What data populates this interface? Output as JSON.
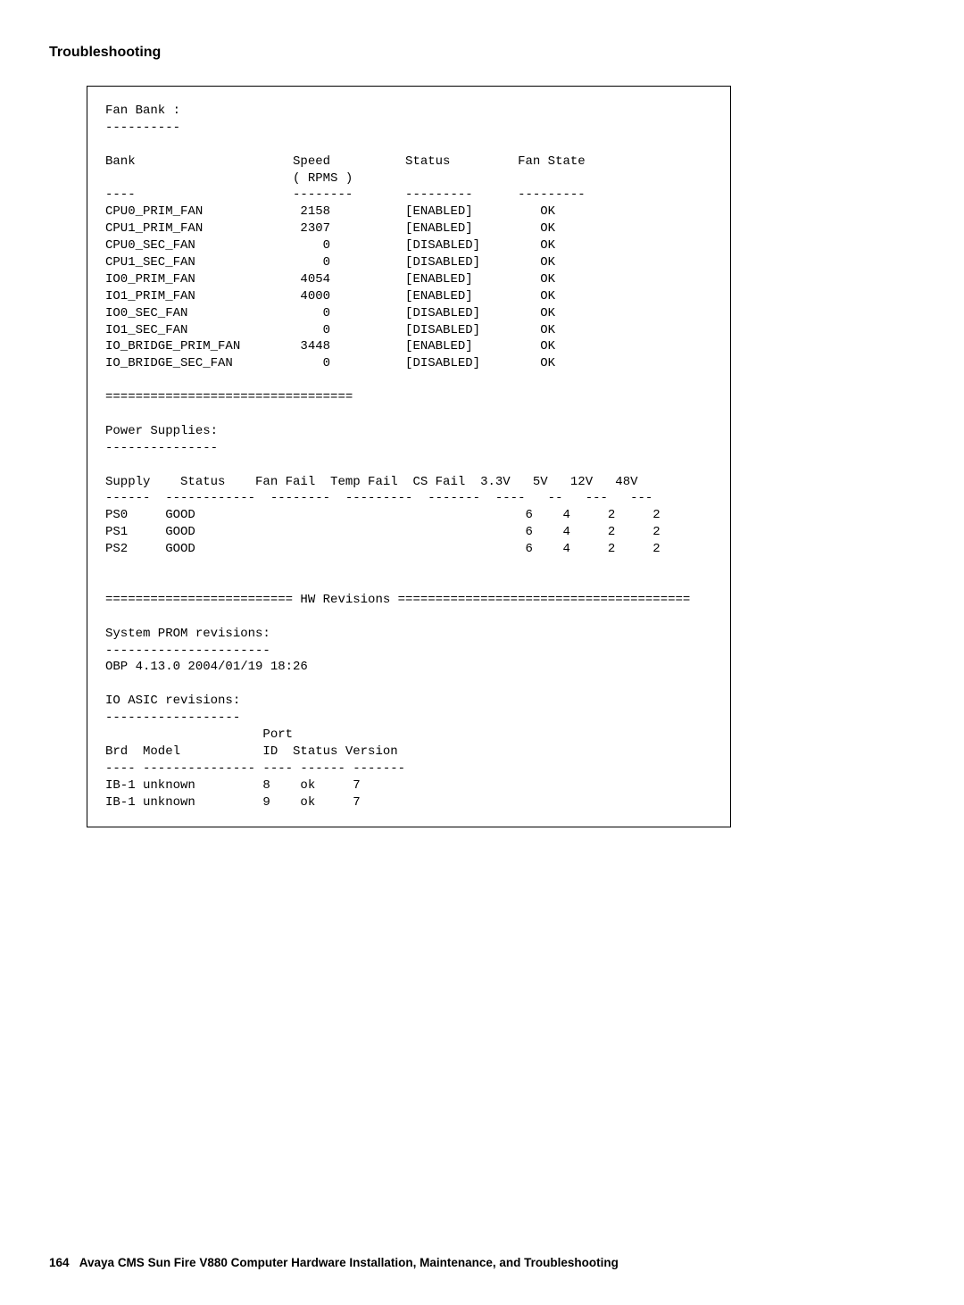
{
  "heading": "Troubleshooting",
  "fan_bank": {
    "title": "Fan Bank :",
    "title_underline": "----------",
    "hdr_bank": "Bank",
    "hdr_speed": "Speed",
    "hdr_rpm": "( RPMS )",
    "hdr_status": "Status",
    "hdr_state": "Fan State",
    "dash_bank": "----",
    "dash_speed": "--------",
    "dash_status": "---------",
    "dash_state": "---------",
    "rows": [
      {
        "bank": "CPU0_PRIM_FAN",
        "speed": "2158",
        "status": "[ENABLED]",
        "state": "OK"
      },
      {
        "bank": "CPU1_PRIM_FAN",
        "speed": "2307",
        "status": "[ENABLED]",
        "state": "OK"
      },
      {
        "bank": "CPU0_SEC_FAN",
        "speed": "0",
        "status": "[DISABLED]",
        "state": "OK"
      },
      {
        "bank": "CPU1_SEC_FAN",
        "speed": "0",
        "status": "[DISABLED]",
        "state": "OK"
      },
      {
        "bank": "IO0_PRIM_FAN",
        "speed": "4054",
        "status": "[ENABLED]",
        "state": "OK"
      },
      {
        "bank": "IO1_PRIM_FAN",
        "speed": "4000",
        "status": "[ENABLED]",
        "state": "OK"
      },
      {
        "bank": "IO0_SEC_FAN",
        "speed": "0",
        "status": "[DISABLED]",
        "state": "OK"
      },
      {
        "bank": "IO1_SEC_FAN",
        "speed": "0",
        "status": "[DISABLED]",
        "state": "OK"
      },
      {
        "bank": "IO_BRIDGE_PRIM_FAN",
        "speed": "3448",
        "status": "[ENABLED]",
        "state": "OK"
      },
      {
        "bank": "IO_BRIDGE_SEC_FAN",
        "speed": "0",
        "status": "[DISABLED]",
        "state": "OK"
      }
    ]
  },
  "divider1": "=================================",
  "power": {
    "title": "Power Supplies:",
    "title_underline": "---------------",
    "hdr": "Supply    Status    Fan Fail  Temp Fail  CS Fail  3.3V   5V   12V   48V",
    "dash": "------  ------------  --------  ---------  -------  ----   --   ---   ---",
    "rows": [
      {
        "supply": "PS0",
        "status": "GOOD",
        "v33": "6",
        "v5": "4",
        "v12": "2",
        "v48": "2"
      },
      {
        "supply": "PS1",
        "status": "GOOD",
        "v33": "6",
        "v5": "4",
        "v12": "2",
        "v48": "2"
      },
      {
        "supply": "PS2",
        "status": "GOOD",
        "v33": "6",
        "v5": "4",
        "v12": "2",
        "v48": "2"
      }
    ]
  },
  "hw_divider": "========================= HW Revisions =======================================",
  "prom": {
    "title": "System PROM revisions:",
    "title_underline": "----------------------",
    "line": "OBP 4.13.0 2004/01/19 18:26"
  },
  "asic": {
    "title": "IO ASIC revisions:",
    "title_underline": "------------------",
    "hdr_port": "Port",
    "hdr_line": "Brd  Model           ID  Status Version",
    "dash": "---- --------------- ---- ------ -------",
    "rows": [
      {
        "brd": "IB-1",
        "model": "unknown",
        "id": "8",
        "status": "ok",
        "version": "7"
      },
      {
        "brd": "IB-1",
        "model": "unknown",
        "id": "9",
        "status": "ok",
        "version": "7"
      }
    ]
  },
  "footer": {
    "page": "164",
    "title": "Avaya CMS Sun Fire V880 Computer Hardware Installation, Maintenance, and Troubleshooting"
  }
}
